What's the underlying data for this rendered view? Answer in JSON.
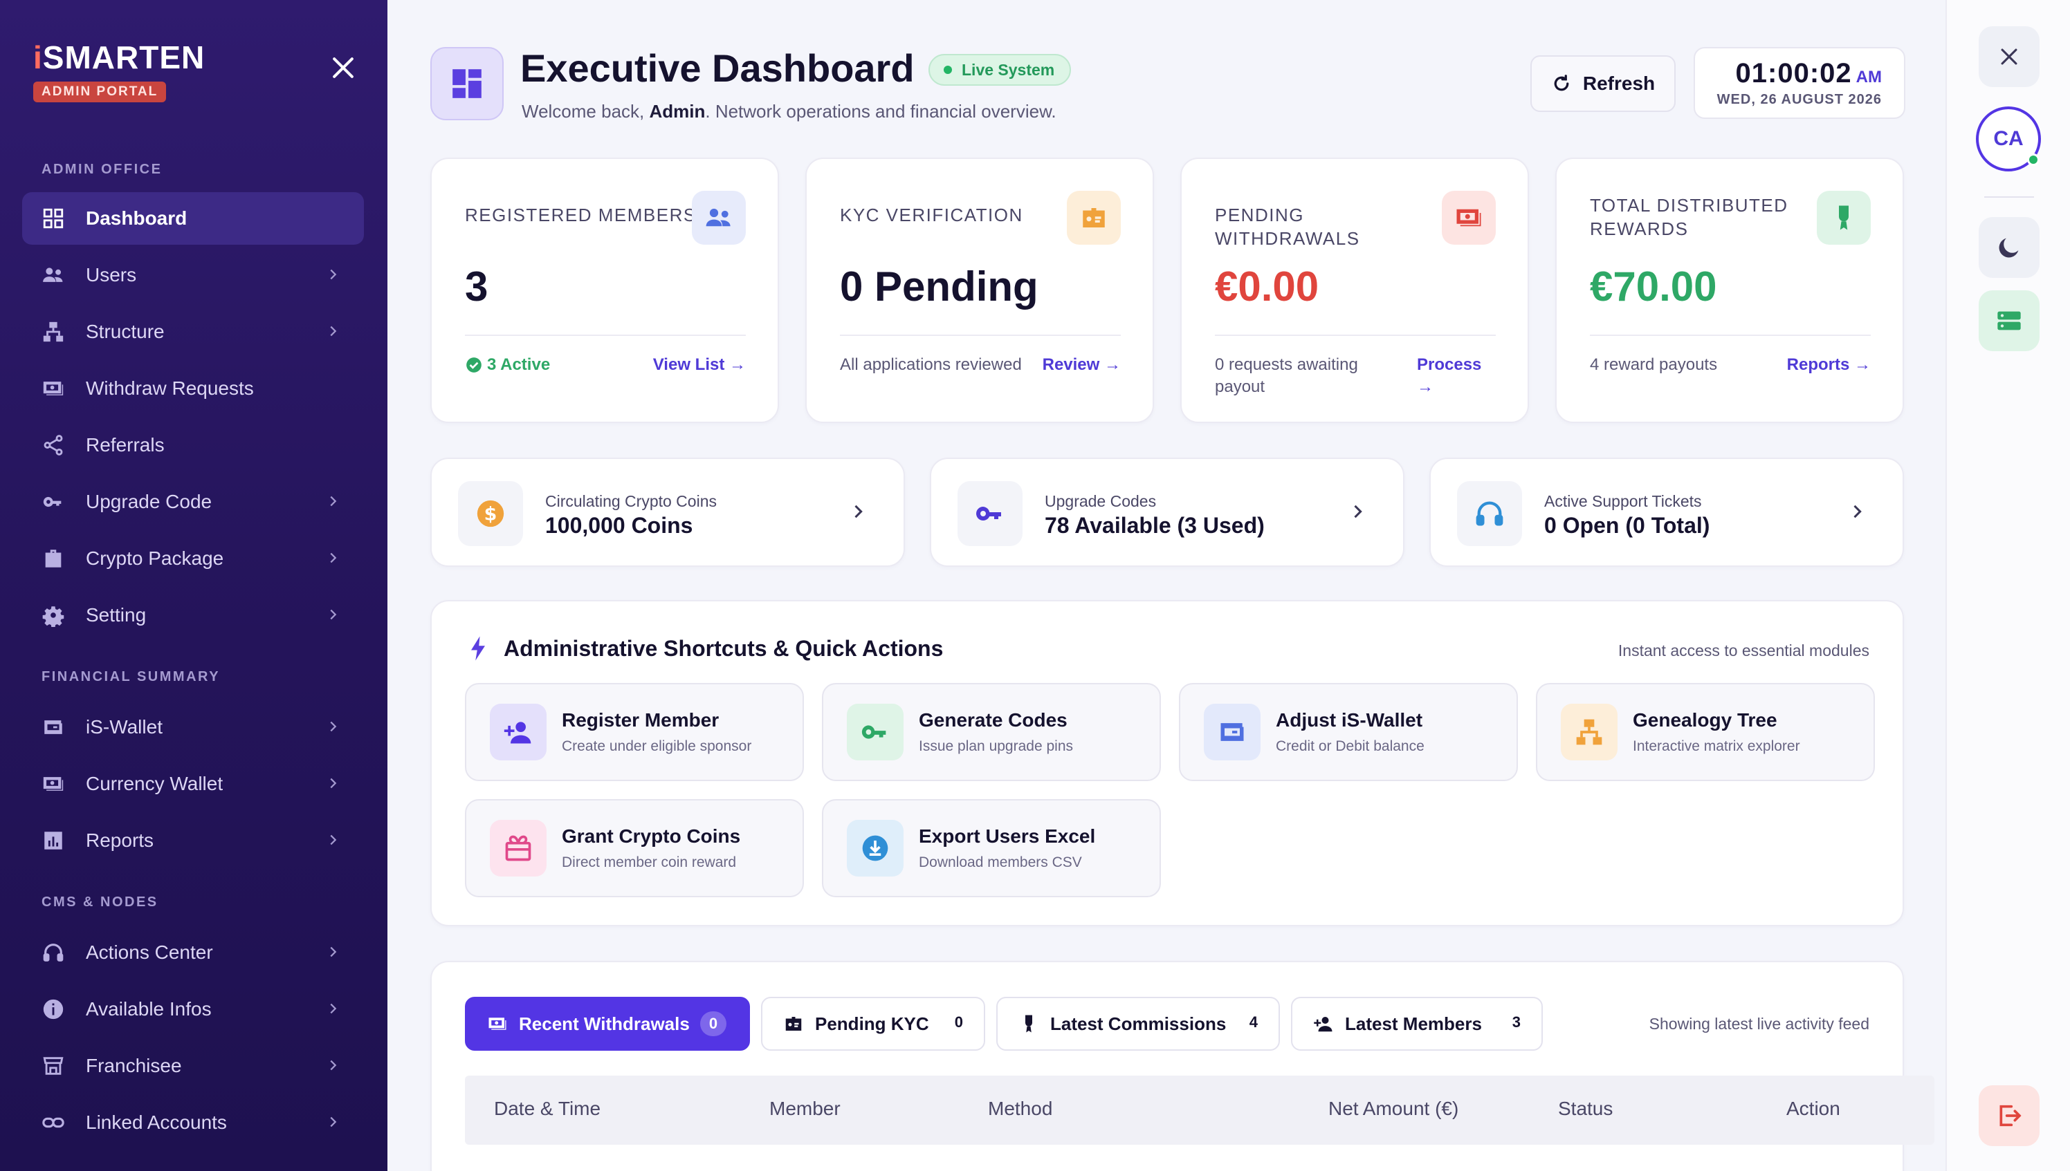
{
  "brand": {
    "name_prefix": "i",
    "name_rest": "SMARTEN",
    "tag": "ADMIN PORTAL"
  },
  "sidebar": {
    "sections": [
      "ADMIN OFFICE",
      "FINANCIAL SUMMARY",
      "CMS & NODES"
    ],
    "items": [
      {
        "label": "Dashboard",
        "icon": "grid-icon",
        "active": true
      },
      {
        "label": "Users",
        "icon": "users-icon"
      },
      {
        "label": "Structure",
        "icon": "sitemap-icon"
      },
      {
        "label": "Withdraw Requests",
        "icon": "money-icon"
      },
      {
        "label": "Referrals",
        "icon": "share-icon"
      },
      {
        "label": "Upgrade Code",
        "icon": "key-icon"
      },
      {
        "label": "Crypto Package",
        "icon": "briefcase-icon"
      },
      {
        "label": "Setting",
        "icon": "gear-icon"
      },
      {
        "label": "iS-Wallet",
        "icon": "wallet-icon"
      },
      {
        "label": "Currency Wallet",
        "icon": "currency-icon"
      },
      {
        "label": "Reports",
        "icon": "chart-icon"
      },
      {
        "label": "Actions Center",
        "icon": "headset-icon"
      },
      {
        "label": "Available Infos",
        "icon": "info-icon"
      },
      {
        "label": "Franchisee",
        "icon": "store-icon"
      },
      {
        "label": "Linked Accounts",
        "icon": "link-icon"
      }
    ]
  },
  "header": {
    "title": "Executive Dashboard",
    "badge": "Live System",
    "sub_prefix": "Welcome back, ",
    "sub_user": "Admin",
    "sub_suffix": ". Network operations and financial overview.",
    "refresh_label": "Refresh",
    "time": "01:00:02",
    "ampm": "AM",
    "date": "WED, 26 AUGUST 2026"
  },
  "stats": [
    {
      "label": "REGISTERED MEMBERS",
      "value": "3",
      "foot": "3 Active",
      "link": "View List →",
      "icon": "users-icon",
      "value_color": "#15122e"
    },
    {
      "label": "KYC VERIFICATION",
      "value": "0 Pending",
      "foot": "All applications reviewed",
      "link": "Review →",
      "icon": "id-card-icon",
      "value_color": "#15122e"
    },
    {
      "label": "PENDING WITHDRAWALS",
      "value": "€0.00",
      "foot": "0 requests awaiting payout",
      "link_line1": "Process",
      "link_line2": "→",
      "icon": "money-icon",
      "value_color": "#e0453d"
    },
    {
      "label": "TOTAL DISTRIBUTED REWARDS",
      "value": "€70.00",
      "foot": "4 reward payouts",
      "link": "Reports →",
      "icon": "award-icon",
      "value_color": "#2ea866"
    }
  ],
  "mini": [
    {
      "label": "Circulating Crypto Coins",
      "value": "100,000 Coins",
      "icon": "coin-icon"
    },
    {
      "label": "Upgrade Codes",
      "value": "78 Available (3 Used)",
      "icon": "key-icon"
    },
    {
      "label": "Active Support Tickets",
      "value": "0 Open (0 Total)",
      "icon": "headset-icon"
    }
  ],
  "quick": {
    "title": "Administrative Shortcuts & Quick Actions",
    "hint": "Instant access to essential modules",
    "tiles": [
      {
        "title": "Register Member",
        "sub": "Create under eligible sponsor",
        "icon": "user-plus-icon"
      },
      {
        "title": "Generate Codes",
        "sub": "Issue plan upgrade pins",
        "icon": "key-icon"
      },
      {
        "title": "Adjust iS-Wallet",
        "sub": "Credit or Debit balance",
        "icon": "wallet-icon"
      },
      {
        "title": "Genealogy Tree",
        "sub": "Interactive matrix explorer",
        "icon": "sitemap-icon"
      },
      {
        "title": "Grant Crypto Coins",
        "sub": "Direct member coin reward",
        "icon": "gift-icon"
      },
      {
        "title": "Export Users Excel",
        "sub": "Download members CSV",
        "icon": "download-icon"
      }
    ]
  },
  "activity": {
    "tabs": [
      {
        "label": "Recent Withdrawals",
        "count": "0",
        "active": true
      },
      {
        "label": "Pending KYC",
        "count": "0"
      },
      {
        "label": "Latest Commissions",
        "count": "4"
      },
      {
        "label": "Latest Members",
        "count": "3"
      }
    ],
    "hint": "Showing latest live activity feed",
    "columns": [
      "Date & Time",
      "Member",
      "Method",
      "Net Amount (€)",
      "Status",
      "Action"
    ]
  },
  "rail": {
    "avatar": "CA"
  },
  "colors": {
    "primary": "#5335e4",
    "danger": "#e0453d",
    "success": "#2ea866",
    "sidebar": "#2a1864"
  }
}
